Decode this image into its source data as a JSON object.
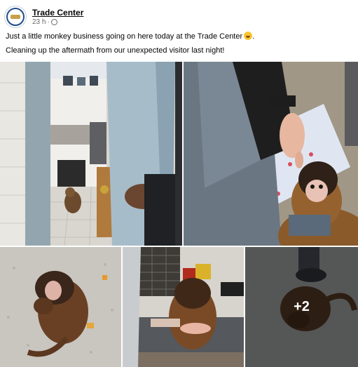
{
  "post": {
    "author": "Trade Center",
    "timestamp": "23 h",
    "separator": "·",
    "privacy_icon": "globe-icon",
    "avatar_icon": "trade-center-logo",
    "line1": "Just a little monkey business going on here today at the Trade Center",
    "line1_emoji": "grinning-face-emoji",
    "line2": "Cleaning up the aftermath from our unexpected visitor last night!",
    "more_photos": "+2"
  },
  "colors": {
    "author_text": "#050505",
    "secondary_text": "#65676b",
    "background": "#ffffff"
  }
}
